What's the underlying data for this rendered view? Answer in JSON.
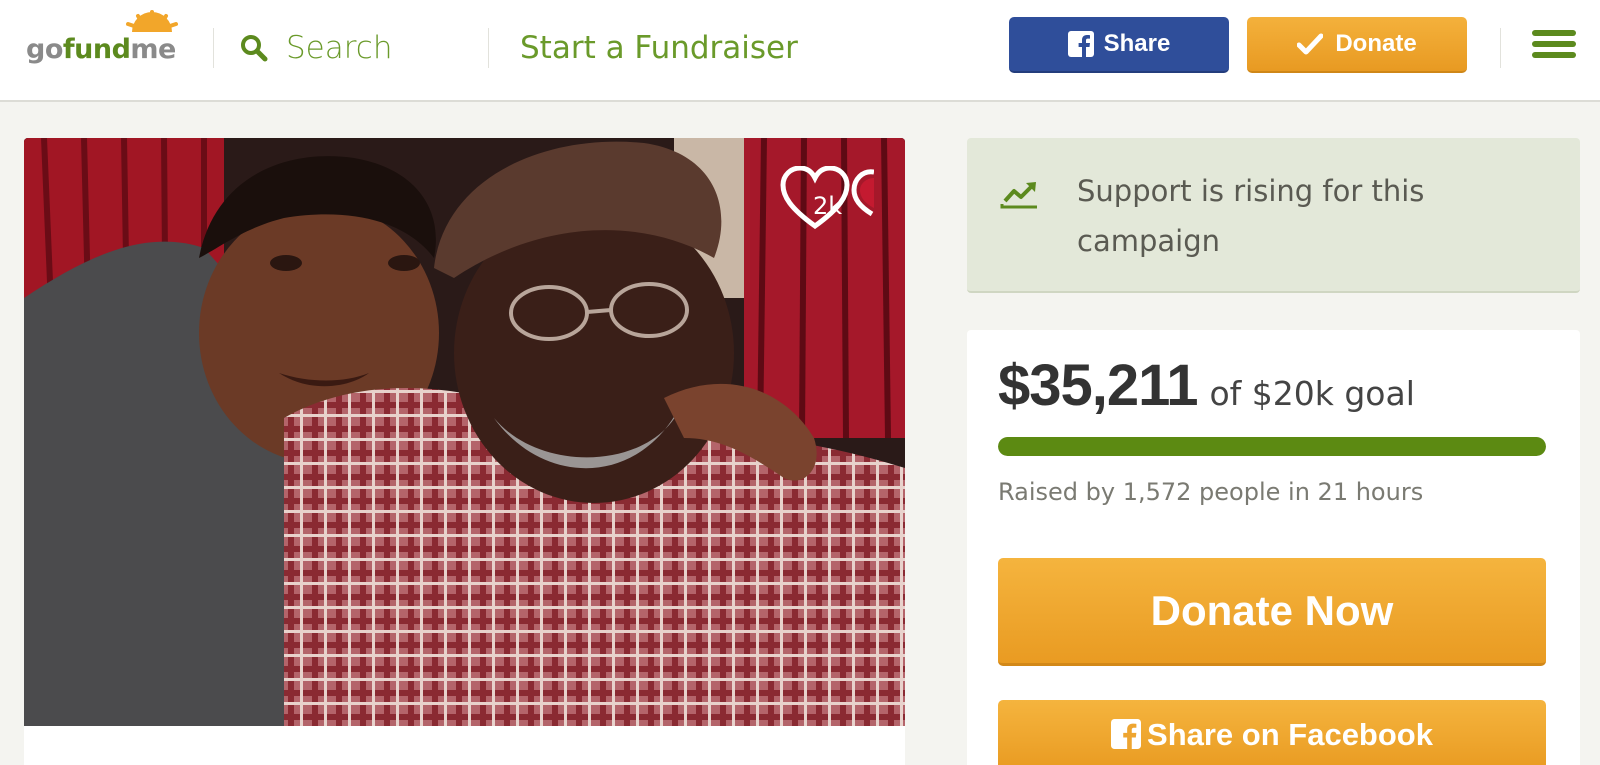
{
  "header": {
    "logo": {
      "go": "go",
      "fund": "fund",
      "me": "me"
    },
    "search_label": "Search",
    "start_link": "Start a Fundraiser",
    "share_label": "Share",
    "donate_label": "Donate",
    "icons": [
      "search-icon",
      "facebook-icon",
      "check-icon",
      "hamburger-menu-icon"
    ]
  },
  "photo": {
    "heart_count": "2k"
  },
  "rising": {
    "text": "Support is rising for this campaign",
    "icon": "trending-up-icon"
  },
  "donation": {
    "amount": "$35,211",
    "goal_text": "of $20k goal",
    "progress_fraction": 1.0,
    "raised_text": "Raised by 1,572 people in 21 hours",
    "donate_now_label": "Donate Now",
    "share_fb_label": "Share on Facebook"
  },
  "colors": {
    "brand_green": "#5c8a1e",
    "facebook_blue": "#2f4e9a",
    "donate_orange": "#f0a62e",
    "rising_bg": "#e3e8d9"
  }
}
